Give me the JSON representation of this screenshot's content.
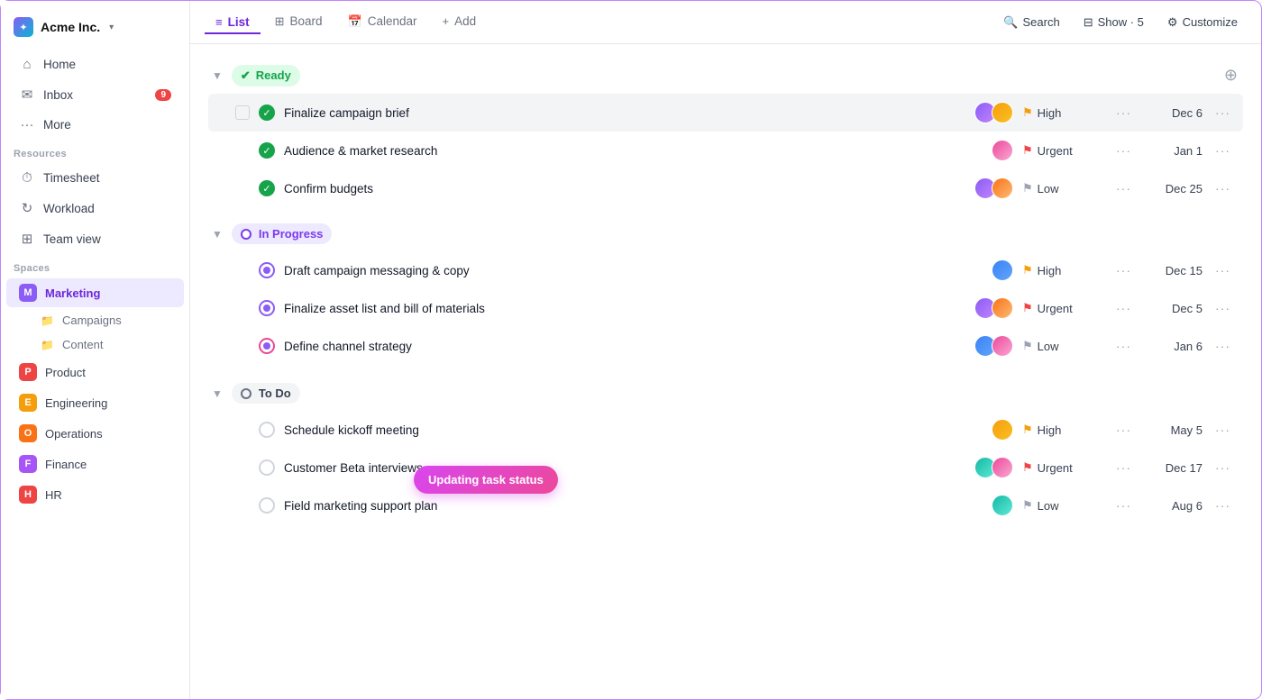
{
  "app": {
    "logo": "Acme Inc.",
    "logo_caret": "▾"
  },
  "sidebar": {
    "nav": [
      {
        "id": "home",
        "icon": "⌂",
        "label": "Home"
      },
      {
        "id": "inbox",
        "icon": "✉",
        "label": "Inbox",
        "badge": "9"
      },
      {
        "id": "more",
        "icon": "···",
        "label": "More"
      }
    ],
    "resources_label": "Resources",
    "resources": [
      {
        "id": "timesheet",
        "icon": "⏱",
        "label": "Timesheet"
      },
      {
        "id": "workload",
        "icon": "↻",
        "label": "Workload"
      },
      {
        "id": "team-view",
        "icon": "⊞",
        "label": "Team view"
      }
    ],
    "spaces_label": "Spaces",
    "spaces": [
      {
        "id": "marketing",
        "letter": "M",
        "label": "Marketing",
        "color": "dot-m",
        "active": true
      },
      {
        "id": "product",
        "letter": "P",
        "label": "Product",
        "color": "dot-p"
      },
      {
        "id": "engineering",
        "letter": "E",
        "label": "Engineering",
        "color": "dot-e"
      },
      {
        "id": "operations",
        "letter": "O",
        "label": "Operations",
        "color": "dot-o"
      },
      {
        "id": "finance",
        "letter": "F",
        "label": "Finance",
        "color": "dot-f"
      },
      {
        "id": "hr",
        "letter": "H",
        "label": "HR",
        "color": "dot-h"
      }
    ],
    "sub_items": [
      {
        "id": "campaigns",
        "label": "Campaigns"
      },
      {
        "id": "content",
        "label": "Content"
      }
    ]
  },
  "topnav": {
    "tabs": [
      {
        "id": "list",
        "icon": "≡",
        "label": "List",
        "active": true
      },
      {
        "id": "board",
        "icon": "⊞",
        "label": "Board"
      },
      {
        "id": "calendar",
        "icon": "📅",
        "label": "Calendar"
      },
      {
        "id": "add",
        "icon": "+",
        "label": "Add"
      }
    ],
    "actions": [
      {
        "id": "search",
        "icon": "🔍",
        "label": "Search"
      },
      {
        "id": "show",
        "icon": "⊟",
        "label": "Show · 5"
      },
      {
        "id": "customize",
        "icon": "⚙",
        "label": "Customize"
      }
    ]
  },
  "sections": [
    {
      "id": "ready",
      "label": "Ready",
      "badge_class": "badge-ready",
      "tasks": [
        {
          "id": "t1",
          "name": "Finalize campaign brief",
          "status": "done",
          "priority": "High",
          "priority_class": "flag-high",
          "date": "Dec 6",
          "avatars": [
            "av-purple",
            "av-yellow"
          ],
          "highlighted": true
        },
        {
          "id": "t2",
          "name": "Audience & market research",
          "status": "done",
          "priority": "Urgent",
          "priority_class": "flag-urgent",
          "date": "Jan 1",
          "avatars": [
            "av-pink"
          ]
        },
        {
          "id": "t3",
          "name": "Confirm budgets",
          "status": "done",
          "priority": "Low",
          "priority_class": "flag-low",
          "date": "Dec 25",
          "avatars": [
            "av-purple",
            "av-orange"
          ]
        }
      ]
    },
    {
      "id": "in-progress",
      "label": "In Progress",
      "badge_class": "badge-in-progress",
      "tasks": [
        {
          "id": "t4",
          "name": "Draft campaign messaging & copy",
          "status": "in-progress",
          "priority": "High",
          "priority_class": "flag-high",
          "date": "Dec 15",
          "avatars": [
            "av-blue"
          ]
        },
        {
          "id": "t5",
          "name": "Finalize asset list and bill of materials",
          "status": "in-progress",
          "priority": "Urgent",
          "priority_class": "flag-urgent",
          "date": "Dec 5",
          "avatars": [
            "av-purple",
            "av-orange"
          ]
        },
        {
          "id": "t6",
          "name": "Define channel strategy",
          "status": "in-progress",
          "priority": "Low",
          "priority_class": "flag-low",
          "date": "Jan 6",
          "avatars": [
            "av-blue",
            "av-pink"
          ],
          "tooltip": true
        }
      ]
    },
    {
      "id": "todo",
      "label": "To Do",
      "badge_class": "badge-todo",
      "tasks": [
        {
          "id": "t7",
          "name": "Schedule kickoff meeting",
          "status": "empty",
          "priority": "High",
          "priority_class": "flag-high",
          "date": "May 5",
          "avatars": [
            "av-yellow"
          ]
        },
        {
          "id": "t8",
          "name": "Customer Beta interviews",
          "status": "empty",
          "priority": "Urgent",
          "priority_class": "flag-urgent",
          "date": "Dec 17",
          "avatars": [
            "av-teal",
            "av-pink"
          ]
        },
        {
          "id": "t9",
          "name": "Field marketing support plan",
          "status": "empty",
          "priority": "Low",
          "priority_class": "flag-low",
          "date": "Aug 6",
          "avatars": [
            "av-teal"
          ]
        }
      ]
    }
  ],
  "tooltip_text": "Updating task status"
}
